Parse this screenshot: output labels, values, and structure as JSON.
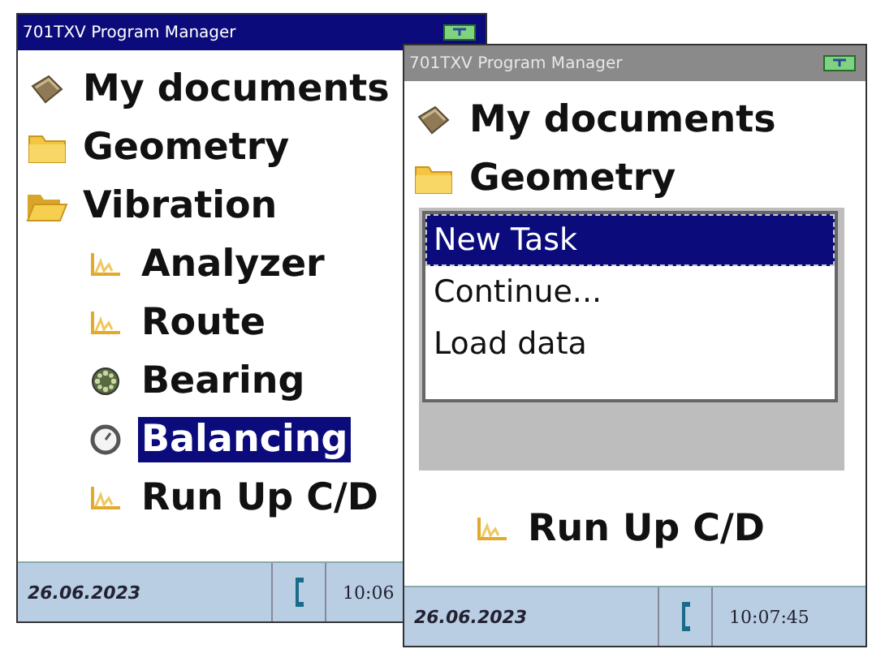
{
  "screens": [
    {
      "title": "701TXV Program Manager",
      "title_bar_active": true,
      "tree": [
        {
          "label": "My documents",
          "kind": "documents",
          "selected": false
        },
        {
          "label": "Geometry",
          "kind": "folder",
          "expanded": false,
          "selected": false
        },
        {
          "label": "Vibration",
          "kind": "folder",
          "expanded": true,
          "selected": false,
          "children": [
            {
              "label": "Analyzer",
              "kind": "chart",
              "selected": false
            },
            {
              "label": "Route",
              "kind": "chart",
              "selected": false
            },
            {
              "label": "Bearing",
              "kind": "gear",
              "selected": false
            },
            {
              "label": "Balancing",
              "kind": "dial",
              "selected": true
            },
            {
              "label": "Run Up C/D",
              "kind": "chart",
              "selected": false
            }
          ]
        }
      ],
      "status_bar": {
        "date": "26.06.2023",
        "time": "10:06"
      }
    },
    {
      "title": "701TXV Program Manager",
      "title_bar_active": false,
      "tree": [
        {
          "label": "My documents",
          "kind": "documents",
          "selected": false
        },
        {
          "label": "Geometry",
          "kind": "folder",
          "expanded": false,
          "selected": false
        }
      ],
      "items_below_menu": [
        {
          "label": "Run Up C/D",
          "kind": "chart",
          "selected": false
        }
      ],
      "menu": {
        "items": [
          {
            "label": "New Task",
            "selected": true
          },
          {
            "label": "Continue...",
            "selected": false
          },
          {
            "label": "Load data",
            "selected": false
          }
        ]
      },
      "status_bar": {
        "date": "26.06.2023",
        "time": "10:07:45"
      }
    }
  ]
}
